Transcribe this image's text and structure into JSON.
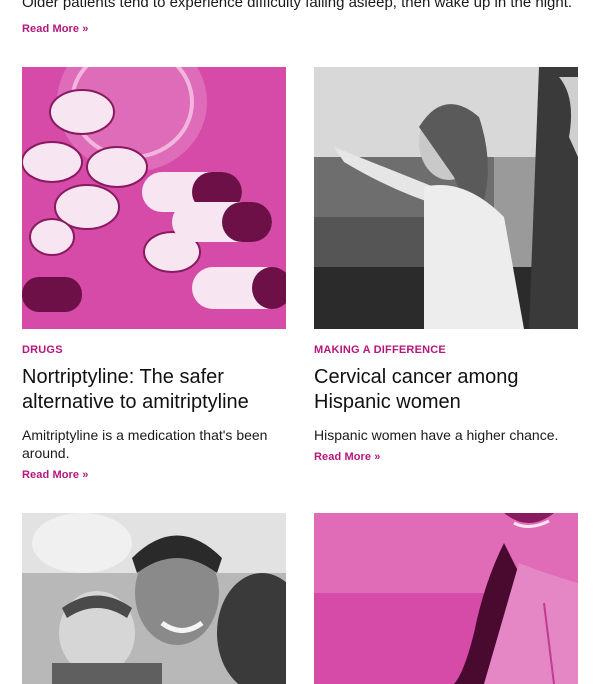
{
  "top_post": {
    "excerpt": "Older patients tend to experience difficulty falling asleep, then wake up in the night.",
    "read_more": "Read More »"
  },
  "cards": [
    {
      "category": "DRUGS",
      "title": "Nortriptyline: The safer alternative to amitriptyline",
      "excerpt": "Amitriptyline is a medication that's been around.",
      "read_more": "Read More »"
    },
    {
      "category": "MAKING A DIFFERENCE",
      "title": "Cervical cancer among Hispanic women",
      "excerpt": "Hispanic women have a higher chance.",
      "read_more": "Read More »"
    }
  ],
  "colors": {
    "accent": "#b5177e",
    "pink_image": "#d64aa8"
  },
  "images": [
    "pills-bottle-image",
    "woman-pointing-car-window-image",
    "father-with-baby-image",
    "nurse-smiling-image"
  ]
}
